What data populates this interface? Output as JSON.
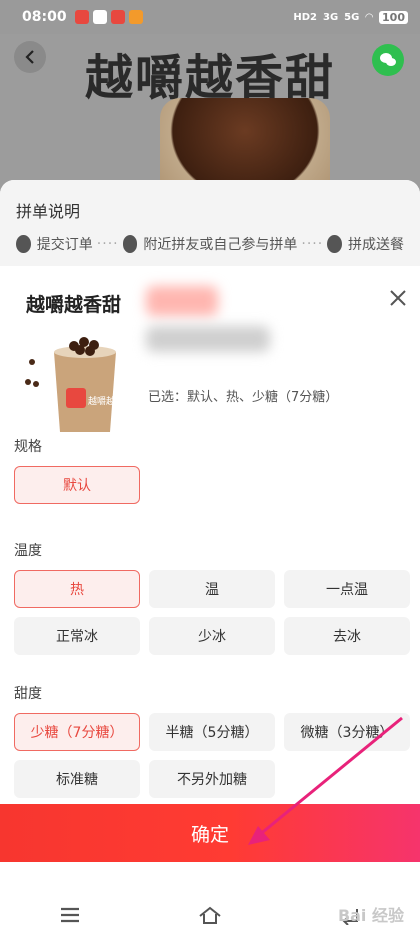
{
  "status_bar": {
    "time": "08:00",
    "network_labels": [
      "HD2",
      "3G",
      "5G"
    ],
    "battery": "100"
  },
  "header": {
    "title": "越嚼越香甜",
    "back_icon": "chevron-left-icon",
    "share_icon": "wechat-icon"
  },
  "pin_guide": {
    "title": "拼单说明",
    "steps": [
      "提交订单",
      "附近拼友或自己参与拼单",
      "拼成送餐"
    ]
  },
  "product": {
    "name": "越嚼越香甜",
    "selected_text": "已选：默认、热、少糖（7分糖）",
    "cup_label": "越嚼越香甜"
  },
  "groups": [
    {
      "label": "规格",
      "options": [
        "默认"
      ],
      "selected": 0
    },
    {
      "label": "温度",
      "options": [
        "热",
        "温",
        "一点温",
        "正常冰",
        "少冰",
        "去冰"
      ],
      "selected": 0
    },
    {
      "label": "甜度",
      "options": [
        "少糖（7分糖）",
        "半糖（5分糖）",
        "微糖（3分糖）",
        "标准糖",
        "不另外加糖"
      ],
      "selected": 0
    }
  ],
  "confirm_label": "确定",
  "watermark": "Bai 经验",
  "colors": {
    "accent": "#f0433a",
    "selected_bg": "#fdeeed",
    "option_bg": "#f3f3f3",
    "arrow": "#e8227a"
  }
}
